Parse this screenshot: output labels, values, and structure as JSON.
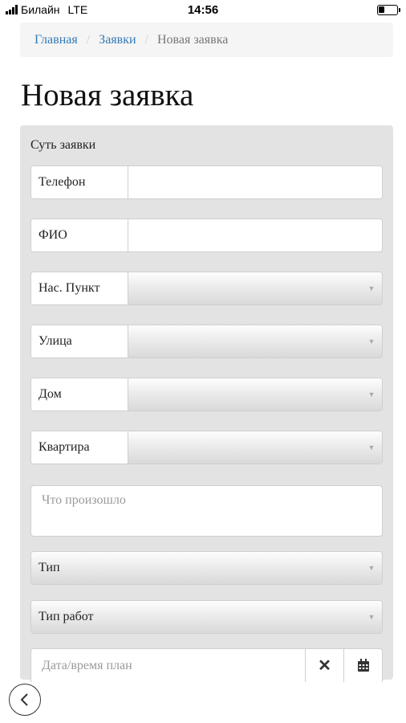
{
  "status_bar": {
    "carrier": "Билайн",
    "network": "LTE",
    "time": "14:56",
    "battery_level": 0.35
  },
  "breadcrumb": {
    "items": [
      "Главная",
      "Заявки"
    ],
    "separator": "/",
    "current": "Новая заявка"
  },
  "page": {
    "title": "Новая заявка"
  },
  "form": {
    "section_label": "Суть заявки",
    "phone": {
      "label": "Телефон",
      "value": ""
    },
    "fio": {
      "label": "ФИО",
      "value": ""
    },
    "locality": {
      "label": "Нас. Пункт",
      "selected": ""
    },
    "street": {
      "label": "Улица",
      "selected": ""
    },
    "house": {
      "label": "Дом",
      "selected": ""
    },
    "apartment": {
      "label": "Квартира",
      "selected": ""
    },
    "description": {
      "placeholder": "Что произошло",
      "value": ""
    },
    "type": {
      "selected": "Тип"
    },
    "work_type": {
      "selected": "Тип работ"
    },
    "planned_datetime": {
      "placeholder": "Дата/время план",
      "value": ""
    }
  },
  "icons": {
    "caret": "caret-down-icon",
    "clear": "close-icon",
    "calendar": "calendar-icon",
    "back": "chevron-left-icon"
  },
  "colors": {
    "link": "#337ab7",
    "panel_bg": "#e3e3e3",
    "breadcrumb_bg": "#f5f5f5"
  }
}
